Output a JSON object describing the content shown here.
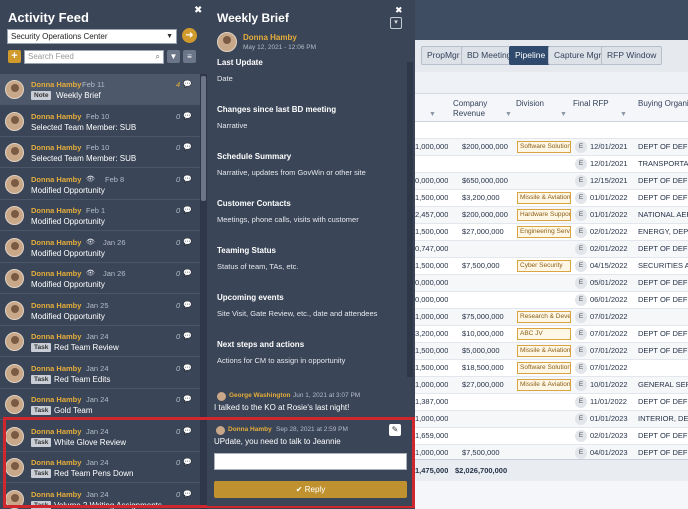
{
  "feed": {
    "title": "Activity Feed",
    "selected_filter": "Security Operations Center",
    "search_placeholder": "Search Feed",
    "items": [
      {
        "name": "Donna Hamby",
        "date": "Feb 11",
        "count": "4",
        "badge": "Note",
        "text": "Weekly Brief"
      },
      {
        "name": "Donna Hamby",
        "date": "Feb 10",
        "count": "0",
        "text": "Selected Team Member: SUB"
      },
      {
        "name": "Donna Hamby",
        "date": "Feb 10",
        "count": "0",
        "text": "Selected Team Member: SUB"
      },
      {
        "name": "Donna Hamby",
        "date": "Feb 8",
        "count": "0",
        "text": "Modified Opportunity"
      },
      {
        "name": "Donna Hamby",
        "date": "Feb 1",
        "count": "0",
        "text": "Modified Opportunity"
      },
      {
        "name": "Donna Hamby",
        "date": "Jan 26",
        "count": "0",
        "text": "Modified Opportunity"
      },
      {
        "name": "Donna Hamby",
        "date": "Jan 26",
        "count": "0",
        "text": "Modified Opportunity"
      },
      {
        "name": "Donna Hamby",
        "date": "Jan 25",
        "count": "0",
        "text": "Modified Opportunity"
      },
      {
        "name": "Donna Hamby",
        "date": "Jan 24",
        "count": "0",
        "badge": "Task",
        "text": "Red Team Review"
      },
      {
        "name": "Donna Hamby",
        "date": "Jan 24",
        "count": "0",
        "badge": "Task",
        "text": "Red Team Edits"
      },
      {
        "name": "Donna Hamby",
        "date": "Jan 24",
        "count": "0",
        "badge": "Task",
        "text": "Gold Team"
      },
      {
        "name": "Donna Hamby",
        "date": "Jan 24",
        "count": "0",
        "badge": "Task",
        "text": "White Glove Review"
      },
      {
        "name": "Donna Hamby",
        "date": "Jan 24",
        "count": "0",
        "badge": "Task",
        "text": "Red Team Pens Down"
      },
      {
        "name": "Donna Hamby",
        "date": "Jan 24",
        "count": "0",
        "badge": "Task",
        "text": "Volume 2 Writing Assignments"
      }
    ]
  },
  "brief": {
    "title": "Weekly Brief",
    "author": "Donna Hamby",
    "date": "May 12, 2021 - 12:06 PM",
    "sections": [
      {
        "title": "Last Update",
        "body": "Date"
      },
      {
        "title": "Changes since last BD meeting",
        "body": "Narrative"
      },
      {
        "title": "Schedule Summary",
        "body": "Narrative, updates from GovWin or other site"
      },
      {
        "title": "Customer Contacts",
        "body": "Meetings, phone calls, visits with customer"
      },
      {
        "title": "Teaming Status",
        "body": "Status of team, TAs, etc."
      },
      {
        "title": "Upcoming events",
        "body": "Site Visit, Gate Review, etc., date and attendees"
      },
      {
        "title": "Next steps and actions",
        "body": "Actions for CM to assign in opportunity"
      }
    ],
    "comments": [
      {
        "name": "George Washington",
        "date": "Jun 1, 2021 at 3:07 PM",
        "text": "I talked to the KO at Rosie's last night!"
      },
      {
        "name": "Donna Hamby",
        "date": "Sep 28, 2021 at 2:59 PM",
        "text": "UPdate, you need to talk to Jeannie"
      }
    ],
    "reply_label": "Reply"
  },
  "grid": {
    "tabs": [
      "PropMgr",
      "BD Meeting",
      "Pipeline",
      "Capture Mgr",
      "RFP Window"
    ],
    "active_tab": "Pipeline",
    "headers": {
      "revenue": "Company\nRevenue",
      "division": "Division",
      "rfp": "Final RFP",
      "org": "Buying Organiz"
    },
    "rows": [
      {
        "a": "",
        "rev": "",
        "div": "",
        "rfp": "",
        "org": ""
      },
      {
        "a": "1,000,000",
        "rev": "$200,000,000",
        "div": "Software Solution",
        "rfp": "12/01/2021",
        "org": "DEPT OF DEFE"
      },
      {
        "a": "",
        "rev": "",
        "div": "",
        "rfp": "12/01/2021",
        "org": "TRANSPORTAT"
      },
      {
        "a": "0,000,000",
        "rev": "$650,000,000",
        "div": "",
        "rfp": "12/15/2021",
        "org": "DEPT OF DEFE"
      },
      {
        "a": "1,500,000",
        "rev": "$3,200,000",
        "div": "Missile & Aviation",
        "rfp": "01/01/2022",
        "org": "DEPT OF DEFE"
      },
      {
        "a": "2,457,000",
        "rev": "$200,000,000",
        "div": "Hardware Support",
        "rfp": "01/01/2022",
        "org": "NATIONAL AER"
      },
      {
        "a": "1,500,000",
        "rev": "$27,000,000",
        "div": "Engineering Servic",
        "rfp": "02/01/2022",
        "org": "ENERGY, DEPA"
      },
      {
        "a": "0,747,000",
        "rev": "",
        "div": "",
        "rfp": "02/01/2022",
        "org": "DEPT OF DEFE"
      },
      {
        "a": "1,500,000",
        "rev": "$7,500,000",
        "div": "Cyber Security",
        "rfp": "04/15/2022",
        "org": "SECURITIES AN"
      },
      {
        "a": "0,000,000",
        "rev": "",
        "div": "",
        "rfp": "05/01/2022",
        "org": "DEPT OF DEFE"
      },
      {
        "a": "0,000,000",
        "rev": "",
        "div": "",
        "rfp": "06/01/2022",
        "org": "DEPT OF DEFE"
      },
      {
        "a": "1,000,000",
        "rev": "$75,000,000",
        "div": "Research & Develo",
        "rfp": "07/01/2022",
        "org": ""
      },
      {
        "a": "3,200,000",
        "rev": "$10,000,000",
        "div": "ABC JV",
        "rfp": "07/01/2022",
        "org": "DEPT OF DEFE"
      },
      {
        "a": "1,500,000",
        "rev": "$5,000,000",
        "div": "Missile & Aviation",
        "rfp": "07/01/2022",
        "org": "DEPT OF DEFE"
      },
      {
        "a": "1,500,000",
        "rev": "$18,500,000",
        "div": "Software Solution",
        "rfp": "07/01/2022",
        "org": ""
      },
      {
        "a": "1,000,000",
        "rev": "$27,000,000",
        "div": "Missile & Aviation",
        "rfp": "10/01/2022",
        "org": "GENERAL SERV"
      },
      {
        "a": "1,387,000",
        "rev": "",
        "div": "",
        "rfp": "11/01/2022",
        "org": "DEPT OF DEFE"
      },
      {
        "a": "1,000,000",
        "rev": "",
        "div": "",
        "rfp": "01/01/2023",
        "org": "INTERIOR, DEP"
      },
      {
        "a": "1,659,000",
        "rev": "",
        "div": "",
        "rfp": "02/01/2023",
        "org": "DEPT OF DEFE"
      },
      {
        "a": "1,000,000",
        "rev": "$7,500,000",
        "div": "",
        "rfp": "04/01/2023",
        "org": "DEPT OF DEFE"
      }
    ],
    "totals": {
      "a": "1,475,000",
      "rev": "$2,026,700,000"
    },
    "rfp_badge": "E"
  }
}
